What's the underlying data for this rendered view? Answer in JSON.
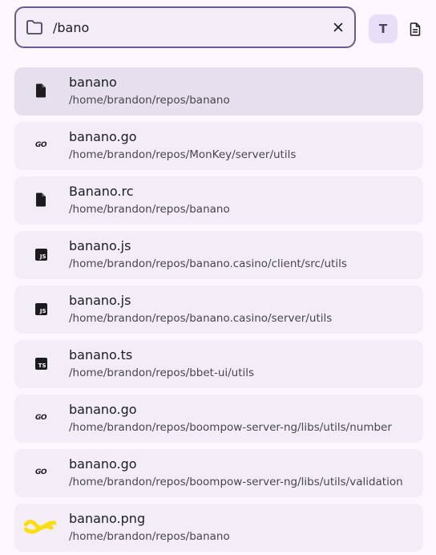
{
  "search": {
    "value": "/bano",
    "placeholder": ""
  },
  "toolbar": {
    "text_mode_label": "T"
  },
  "results": [
    {
      "name": "banano",
      "path": "/home/brandon/repos/banano",
      "icon": "file-icon",
      "selected": true
    },
    {
      "name": "banano.go",
      "path": "/home/brandon/repos/MonKey/server/utils",
      "icon": "go-icon"
    },
    {
      "name": "Banano.rc",
      "path": "/home/brandon/repos/banano",
      "icon": "file-icon"
    },
    {
      "name": "banano.js",
      "path": "/home/brandon/repos/banano.casino/client/src/utils",
      "icon": "js-icon",
      "badge": "JS"
    },
    {
      "name": "banano.js",
      "path": "/home/brandon/repos/banano.casino/server/utils",
      "icon": "js-icon",
      "badge": "JS"
    },
    {
      "name": "banano.ts",
      "path": "/home/brandon/repos/bbet-ui/utils",
      "icon": "ts-icon",
      "badge": "TS"
    },
    {
      "name": "banano.go",
      "path": "/home/brandon/repos/boompow-server-ng/libs/utils/number",
      "icon": "go-icon"
    },
    {
      "name": "banano.go",
      "path": "/home/brandon/repos/boompow-server-ng/libs/utils/validation",
      "icon": "go-icon"
    },
    {
      "name": "banano.png",
      "path": "/home/brandon/repos/banano",
      "icon": "banano-logo-icon"
    }
  ],
  "icon_labels": {
    "go": "GO"
  },
  "colors": {
    "background": "#fdf7ff",
    "search_border": "#6a5a8e",
    "item_bg": "#f3edf7",
    "item_selected_bg": "#e6e0ee",
    "accent_button": "#e8def8",
    "banano_yellow": "#fbdd11"
  }
}
